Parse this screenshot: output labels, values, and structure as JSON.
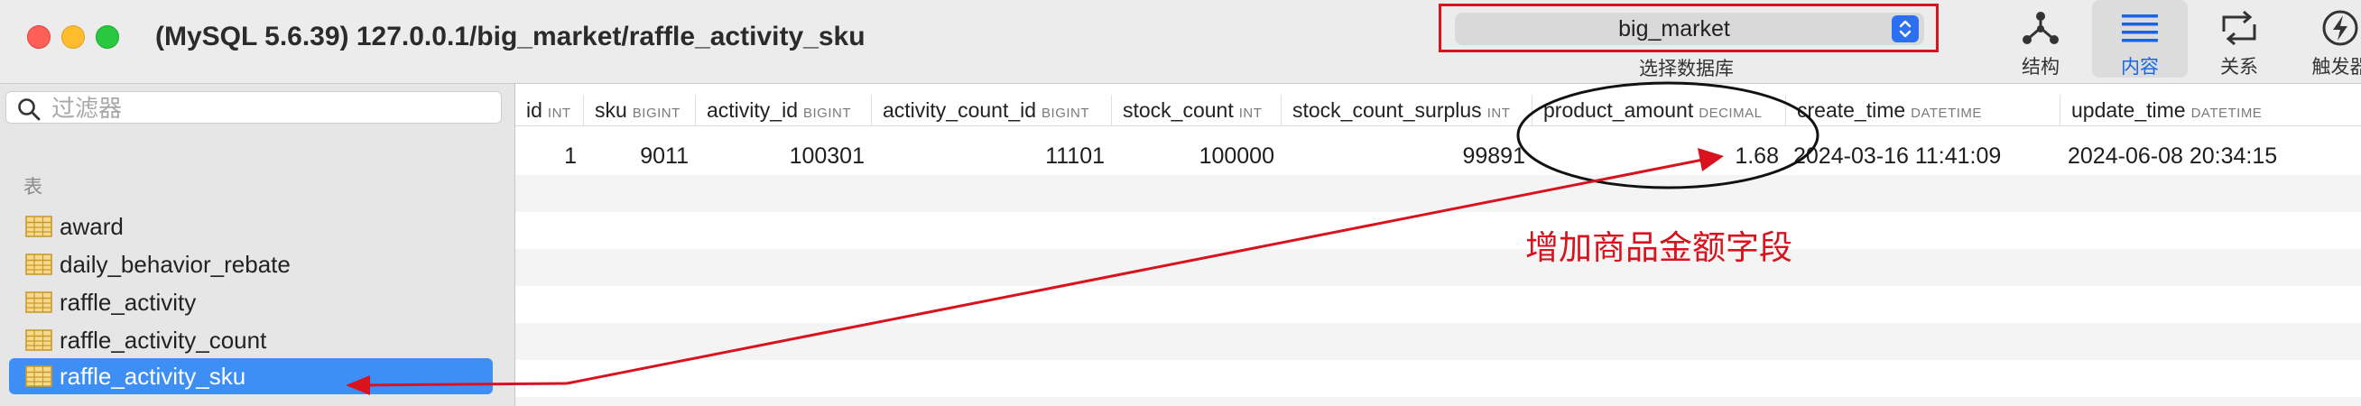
{
  "window": {
    "title": "(MySQL 5.6.39) 127.0.0.1/big_market/raffle_activity_sku"
  },
  "toolbar": {
    "database": {
      "value": "big_market",
      "caption": "选择数据库"
    },
    "buttons": [
      {
        "label": "结构",
        "icon": "structure-icon"
      },
      {
        "label": "内容",
        "icon": "content-list-icon",
        "active": true
      },
      {
        "label": "关系",
        "icon": "relations-icon"
      },
      {
        "label": "触发器",
        "icon": "trigger-icon"
      }
    ]
  },
  "sidebar": {
    "filter_placeholder": "过滤器",
    "section_label": "表",
    "tables": [
      {
        "name": "award"
      },
      {
        "name": "daily_behavior_rebate"
      },
      {
        "name": "raffle_activity"
      },
      {
        "name": "raffle_activity_count"
      },
      {
        "name": "raffle_activity_sku",
        "selected": true
      }
    ]
  },
  "grid": {
    "columns": [
      {
        "name": "id",
        "type": "INT"
      },
      {
        "name": "sku",
        "type": "BIGINT"
      },
      {
        "name": "activity_id",
        "type": "BIGINT"
      },
      {
        "name": "activity_count_id",
        "type": "BIGINT"
      },
      {
        "name": "stock_count",
        "type": "INT"
      },
      {
        "name": "stock_count_surplus",
        "type": "INT"
      },
      {
        "name": "product_amount",
        "type": "DECIMAL"
      },
      {
        "name": "create_time",
        "type": "DATETIME"
      },
      {
        "name": "update_time",
        "type": "DATETIME"
      }
    ],
    "rows": [
      [
        "1",
        "9011",
        "100301",
        "11101",
        "100000",
        "99891",
        "1.68",
        "2024-03-16 11:41:09",
        "2024-06-08 20:34:15"
      ]
    ]
  },
  "annotation": {
    "text": "增加商品金额字段",
    "color": "#d8131e"
  },
  "colors": {
    "accent": "#2c6ff2",
    "selection": "#3d8ff5",
    "annotation": "#d8131e"
  }
}
